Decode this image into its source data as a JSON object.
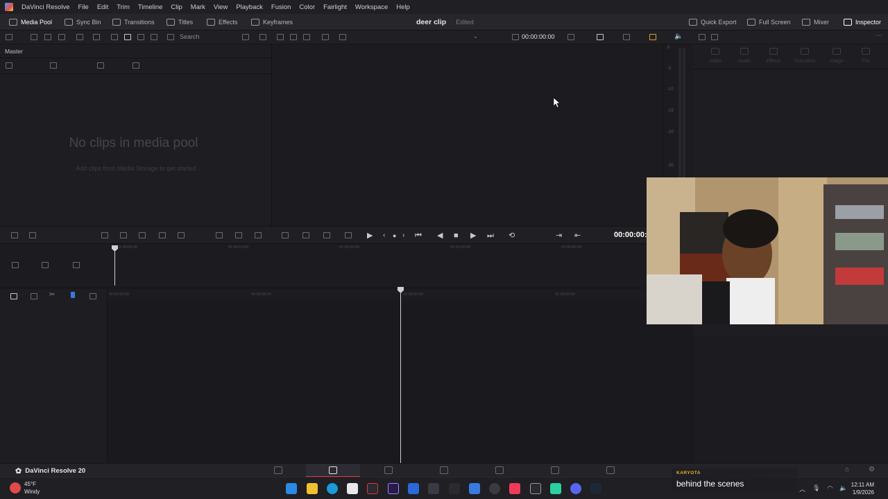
{
  "menubar": {
    "app_title": "DaVinci Resolve",
    "items": [
      "File",
      "Edit",
      "Trim",
      "Timeline",
      "Clip",
      "Mark",
      "View",
      "Playback",
      "Fusion",
      "Color",
      "Fairlight",
      "Workspace",
      "Help"
    ]
  },
  "toolbar": {
    "media_pool": "Media Pool",
    "sync_bin": "Sync Bin",
    "transitions": "Transitions",
    "titles": "Titles",
    "effects": "Effects",
    "keyframes": "Keyframes",
    "quick_export": "Quick Export",
    "full_screen": "Full Screen",
    "mixer": "Mixer",
    "inspector": "Inspector"
  },
  "project": {
    "title": "deer clip",
    "status": "Edited"
  },
  "secbar": {
    "search_placeholder": "Search",
    "timecode": "00:00:00:00"
  },
  "media_pool": {
    "bin": "Master",
    "empty_title": "No clips in media pool",
    "empty_hint": "Add clips from Media Storage to get started"
  },
  "meter": {
    "labels": [
      "0",
      "-5",
      "-10",
      "-15",
      "-20",
      "-30"
    ]
  },
  "inspector_tabs": [
    "Video",
    "Audio",
    "Effects",
    "Transition",
    "Image",
    "File"
  ],
  "transport": {
    "timecode": "00:00:00:"
  },
  "ruler_upper": [
    "01:00:00:00",
    "01:00:10:00",
    "01:00:20:00",
    "01:00:30:00",
    "01:00:40:00"
  ],
  "ruler_lower": [
    "00:59:56:00",
    "00:59:58:00",
    "01:00:00:00",
    "01:00:02:00"
  ],
  "pagebar": {
    "app_name": "DaVinci Resolve 20"
  },
  "taskbar": {
    "temperature": "45°F",
    "weather": "Windy",
    "time": "12:11 AM",
    "date": "1/9/2026"
  },
  "overlay": {
    "label": "KARYOTA",
    "text": "behind the scenes"
  },
  "colors": {
    "accent_red": "#e03a3a",
    "panel": "#1e1e22",
    "background": "#1c1c20"
  }
}
